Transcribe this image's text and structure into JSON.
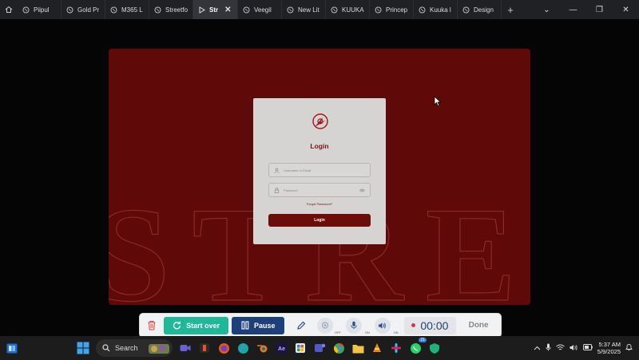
{
  "browser": {
    "tabs": [
      {
        "label": "Piipul",
        "active": false
      },
      {
        "label": "Gold Pr",
        "active": false
      },
      {
        "label": "M365 L",
        "active": false
      },
      {
        "label": "Streetfo",
        "active": false
      },
      {
        "label": "Str",
        "active": true
      },
      {
        "label": "Veegil",
        "active": false
      },
      {
        "label": "New Lit",
        "active": false
      },
      {
        "label": "KUUKA",
        "active": false
      },
      {
        "label": "Princep",
        "active": false
      },
      {
        "label": "Kuuka l",
        "active": false
      },
      {
        "label": "Design",
        "active": false
      }
    ],
    "new_tab": "+",
    "window_controls": {
      "menu": "⌄",
      "minimize": "—",
      "restore": "❐",
      "close": "✕"
    },
    "tab_close": "✕"
  },
  "page": {
    "login_card": {
      "title": "Login",
      "username_placeholder": "Username or Email",
      "password_placeholder": "Password",
      "forgot": "Forgot Password?",
      "button": "Login"
    },
    "watermark_text": "STREE",
    "colors": {
      "panel": "#5f0a08",
      "accent": "#7a1212",
      "button": "#6c0d0a"
    }
  },
  "recorder": {
    "start_over": "Start over",
    "pause": "Pause",
    "camera_state": "OFF",
    "mic_state": "ON",
    "audio_state": "ON",
    "timer": "00:00",
    "done": "Done",
    "colors": {
      "start": "#1fb898",
      "pause": "#1d3f7b"
    }
  },
  "taskbar": {
    "search": "Search",
    "whatsapp_badge": "21",
    "time": "5:37 AM",
    "date": "5/9/2025"
  }
}
